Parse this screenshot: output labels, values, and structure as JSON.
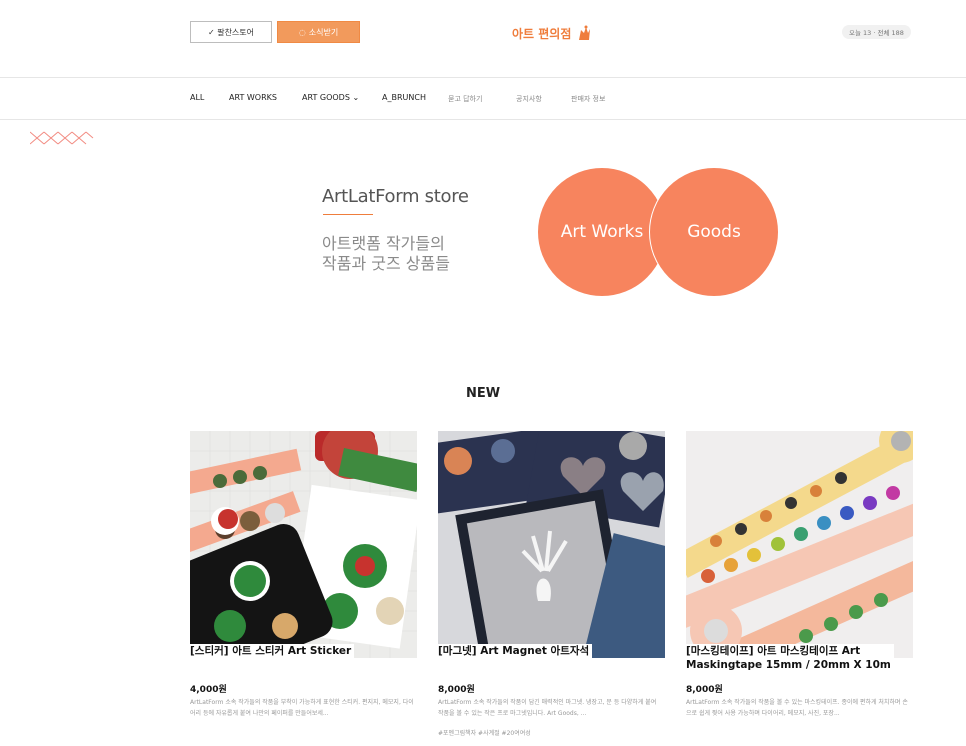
{
  "header": {
    "follow_label": "✓ 팔찬스토어",
    "news_label": "소식받기",
    "brand": "아트 편의점",
    "stats": "오늘 13 · 전체 188"
  },
  "nav": {
    "items": [
      "ALL",
      "ART WORKS",
      "ART GOODS ⌄",
      "A_BRUNCH",
      "묻고 답하기",
      "공지사항",
      "판매자 정보"
    ]
  },
  "hero": {
    "title_en": "ArtLatForm store",
    "line1": "아트랫폼 작가들의",
    "line2": "작품과 굿즈 상품들",
    "circle1": "Art Works",
    "circle2": "Goods"
  },
  "section": {
    "new_title": "NEW"
  },
  "products": [
    {
      "title": "[스티커] 아트 스티커 Art Sticker",
      "price": "4,000원",
      "desc": "ArtLatForm 소속 작가들의 작품을 부착이 가능하게 표현한 스티커. 편지지, 메모지, 다이어리 등에 자유롭게 붙여 나만의 페이퍼를 만들어보세..."
    },
    {
      "title": "[마그넷] Art Magnet 아트자석",
      "price": "8,000원",
      "desc": "ArtLatForm 소속 작가들의 작품이 담긴 매력적인 마그넷. 냉장고, 문 등 다양하게 붙여 작품을 볼 수 있는 작은 프로 마그넷입니다. Art Goods, ...",
      "tags": "#포멘그림책자 #사계절 #20여여성"
    },
    {
      "title_line1": "[마스킹테이프] 아트 마스킹테이프 Art",
      "title_line2": "Maskingtape 15mm / 20mm X 10m",
      "price": "8,000원",
      "desc": "ArtLatForm 소속 작가들의 작품을 볼 수 있는 마스킹테이프. 종이에 편하게 처치하며 손으로 쉽게 찢어 사용 가능하며 다이어리, 메모지, 사진, 포장..."
    }
  ],
  "colors": {
    "accent": "#ef7d3c",
    "circle": "#f7845e",
    "deco": "#f28b82"
  }
}
